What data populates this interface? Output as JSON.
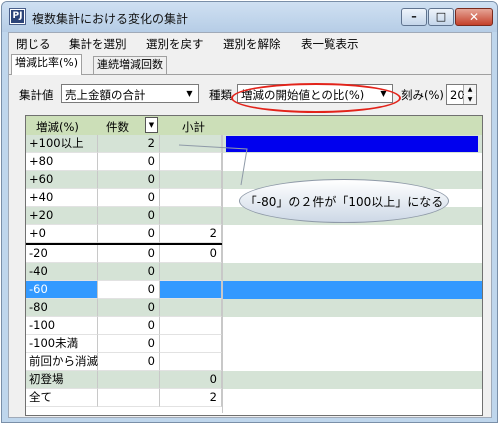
{
  "window": {
    "app_icon_text": "PJ",
    "title": "複数集計における変化の集計",
    "min_glyph": "–",
    "max_glyph": "□",
    "close_glyph": "✕"
  },
  "menu": [
    "閉じる",
    "集計を選別",
    "選別を戻す",
    "選別を解除",
    "表一覧表示"
  ],
  "tabs": [
    "増減比率(%)",
    "連続増減回数"
  ],
  "controls": {
    "value_label": "集計値",
    "value_selected": "売上金額の合計",
    "type_label": "種類",
    "type_selected": "増減の開始値との比(%)",
    "step_label": "刻み(%)",
    "step_value": "20"
  },
  "table": {
    "headers": [
      "増減(%)",
      "件数",
      "小計"
    ],
    "sort_glyph": "▼",
    "rows": [
      {
        "label": "+100以上",
        "count": "2",
        "subtotal": ""
      },
      {
        "label": "+80",
        "count": "0",
        "subtotal": ""
      },
      {
        "label": "+60",
        "count": "0",
        "subtotal": ""
      },
      {
        "label": "+40",
        "count": "0",
        "subtotal": ""
      },
      {
        "label": "+20",
        "count": "0",
        "subtotal": ""
      },
      {
        "label": "+0",
        "count": "0",
        "subtotal": "2"
      },
      {
        "label": "-20",
        "count": "0",
        "subtotal": "0"
      },
      {
        "label": "-40",
        "count": "0",
        "subtotal": ""
      },
      {
        "label": "-60",
        "count": "0",
        "subtotal": ""
      },
      {
        "label": "-80",
        "count": "0",
        "subtotal": ""
      },
      {
        "label": "-100",
        "count": "0",
        "subtotal": ""
      },
      {
        "label": "-100未満",
        "count": "0",
        "subtotal": ""
      },
      {
        "label": "前回から消滅",
        "count": "0",
        "subtotal": ""
      },
      {
        "label": "初登場",
        "count": "",
        "subtotal": "0"
      },
      {
        "label": "全て",
        "count": "",
        "subtotal": "2"
      }
    ]
  },
  "callout": "「-80」の２件が「100以上」になる",
  "colors": {
    "header_bg": "#ccdfb8",
    "alt_row": "#d5e3d6",
    "selection": "#3399ff",
    "bar": "#0000ee",
    "highlight": "#e2231a"
  }
}
